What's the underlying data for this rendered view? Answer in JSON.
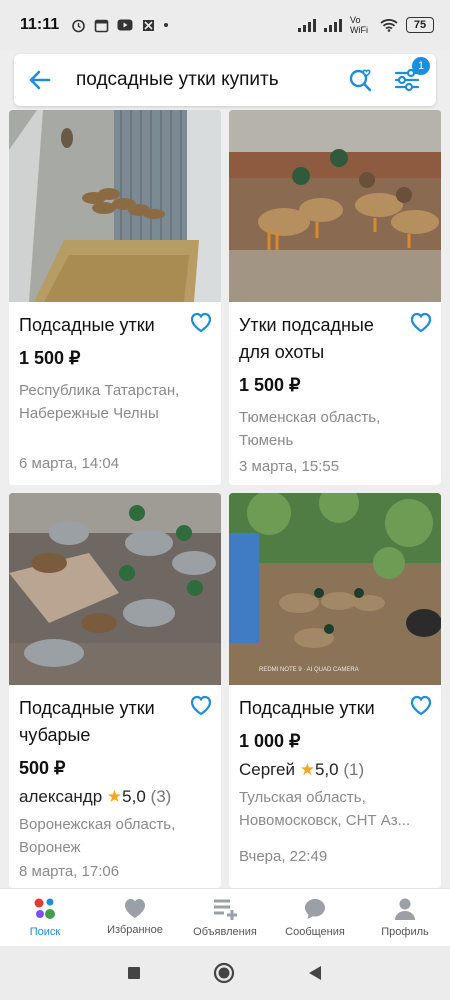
{
  "status": {
    "time": "11:11",
    "battery": "75",
    "network": "Vo WiFi"
  },
  "search": {
    "query": "подсадные утки купить",
    "filter_badge": "1"
  },
  "listings": [
    {
      "title": "Подсадные утки",
      "price": "1 500 ₽",
      "location": "Республика Татарстан, Набережные Челны",
      "date": "6 марта, 14:04"
    },
    {
      "title": "Утки подсадные для охоты",
      "price": "1 500 ₽",
      "location": "Тюменская область, Тюмень",
      "date": "3 марта, 15:55"
    },
    {
      "title": "Подсадные утки чубарые",
      "price": "500 ₽",
      "seller": "александр",
      "rating": "5,0",
      "reviews": "(3)",
      "location": "Воронежская область, Воронеж",
      "date": "8 марта, 17:06"
    },
    {
      "title": "Подсадные утки",
      "price": "1 000 ₽",
      "seller": "Сергей",
      "rating": "5,0",
      "reviews": "(1)",
      "location": "Тульская область, Новомосковск, СНТ Аз...",
      "date": "Вчера, 22:49"
    }
  ],
  "bottom_nav": [
    {
      "label": "Поиск",
      "icon": "search-dots-icon",
      "active": true
    },
    {
      "label": "Избранное",
      "icon": "heart-icon",
      "active": false
    },
    {
      "label": "Объявления",
      "icon": "listings-add-icon",
      "active": false
    },
    {
      "label": "Сообщения",
      "icon": "chat-bubble-icon",
      "active": false
    },
    {
      "label": "Профиль",
      "icon": "user-icon",
      "active": false
    }
  ],
  "colors": {
    "accent": "#1d8dde",
    "star": "#f5a623",
    "muted_text": "#8a8a8a"
  }
}
